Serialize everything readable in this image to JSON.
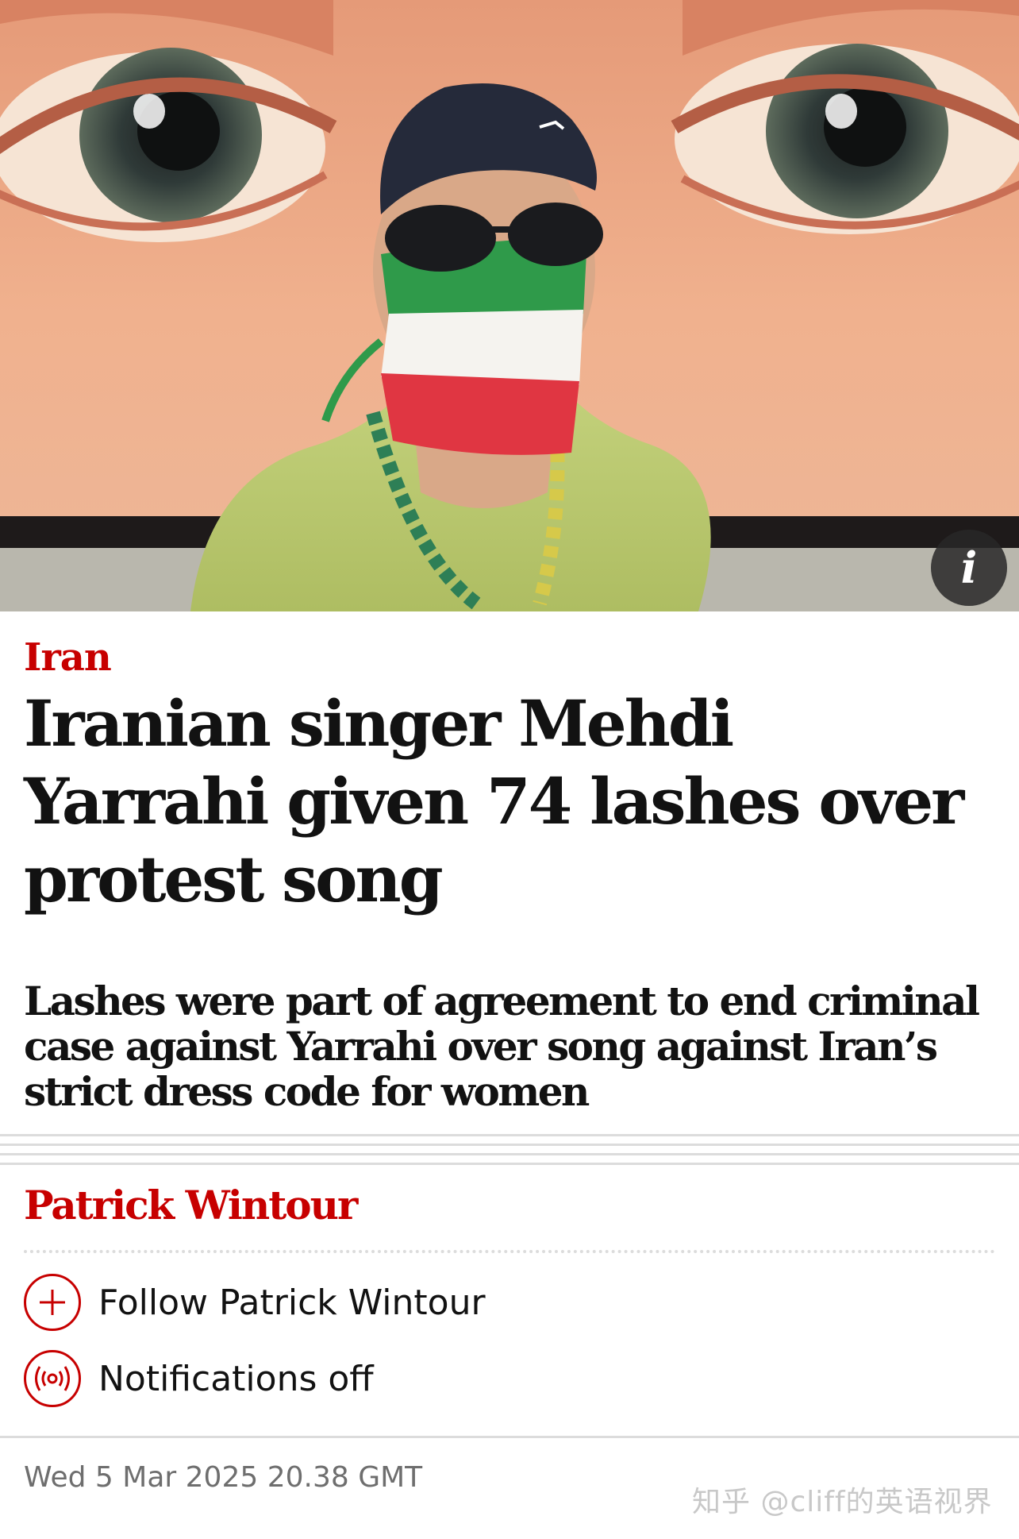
{
  "hero": {
    "image_alt": "Masked protester wearing a cap and sunglasses in front of a large mural of eyes",
    "info_icon": "info-icon",
    "info_glyph": "i"
  },
  "article": {
    "section": "Iran",
    "headline": "Iranian singer Mehdi Yarrahi given 74 lashes over protest song",
    "standfirst": "Lashes were part of agreement to end criminal case against Yarrahi over song against Iran’s strict dress code for women",
    "byline": "Patrick Wintour",
    "follow_label": "Follow Patrick Wintour",
    "follow_icon": "plus-circle-icon",
    "notifications_label": "Notifications off",
    "notifications_icon": "broadcast-icon",
    "date": "Wed 5 Mar 2025 20.38 GMT"
  },
  "watermark": "知乎 @cliff的英语视界",
  "colors": {
    "accent_red": "#c70000",
    "text": "#121212",
    "meta_grey": "#6e6e6e",
    "rule": "#dcdcdc"
  }
}
